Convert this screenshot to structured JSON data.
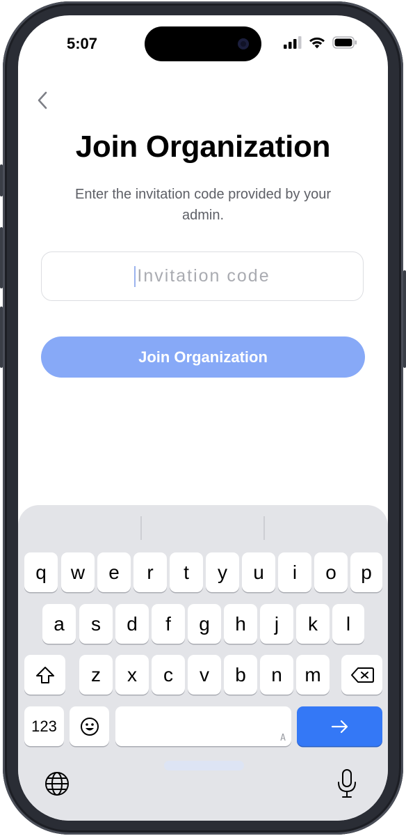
{
  "status_bar": {
    "time": "5:07"
  },
  "header": {
    "back_icon": "chevron-left-icon"
  },
  "page": {
    "title": "Join Organization",
    "subtitle": "Enter the invitation code provided by your admin."
  },
  "form": {
    "invitation_code": {
      "value": "",
      "placeholder": "Invitation code"
    },
    "submit_label": "Join Organization"
  },
  "colors": {
    "accent": "#87a9f7",
    "keyboard_return": "#3478f6",
    "keyboard_bg": "#e3e4e8"
  },
  "keyboard": {
    "row1": [
      "q",
      "w",
      "e",
      "r",
      "t",
      "y",
      "u",
      "i",
      "o",
      "p"
    ],
    "row2": [
      "a",
      "s",
      "d",
      "f",
      "g",
      "h",
      "j",
      "k",
      "l"
    ],
    "row3": [
      "z",
      "x",
      "c",
      "v",
      "b",
      "n",
      "m"
    ],
    "numbers_label": "123",
    "space_hint": "A",
    "icons": {
      "shift": "shift-icon",
      "delete": "backspace-icon",
      "emoji": "emoji-icon",
      "return": "arrow-right-icon",
      "globe": "globe-icon",
      "mic": "microphone-icon"
    }
  }
}
